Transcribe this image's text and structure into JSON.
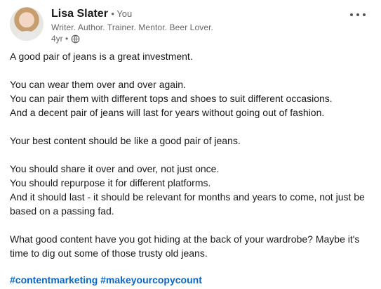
{
  "author": {
    "name": "Lisa Slater",
    "relation": "• You",
    "headline": "Writer. Author. Trainer. Mentor. Beer Lover.",
    "timestamp": "4yr •",
    "visibility_icon": "globe-icon"
  },
  "post": {
    "paragraphs": [
      [
        "A good pair of jeans is a great investment."
      ],
      [
        "You can wear them over and over again.",
        "You can pair them with different tops and shoes to suit different occasions.",
        "And a decent pair of jeans will last for years without going out of fashion."
      ],
      [
        "Your best content should be like a good pair of jeans."
      ],
      [
        "You should share it over and over, not just once.",
        "You should repurpose it for different platforms.",
        "And it should last - it should be relevant for months and years to come, not just be",
        "based on a passing fad."
      ],
      [
        "What good content have you got hiding at the back of your wardrobe? Maybe it's",
        "time to dig out some of those trusty old jeans."
      ]
    ],
    "hashtags": [
      "#contentmarketing",
      "#makeyourcopycount"
    ]
  },
  "colors": {
    "link": "#0a66c2",
    "text": "#191919",
    "muted": "#666666"
  }
}
